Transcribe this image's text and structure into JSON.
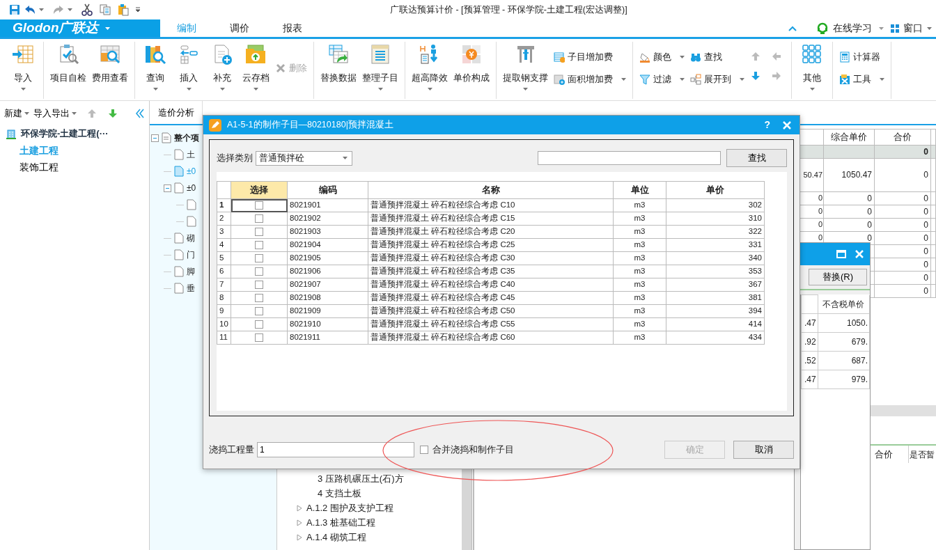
{
  "title_bar": {
    "title": "广联达预算计价 - [预算管理 - 环保学院-土建工程(宏达调整)]"
  },
  "ribbon_tabs": {
    "logo": "Glodon广联达",
    "tabs": [
      {
        "label": "编制",
        "selected": true
      },
      {
        "label": "调价",
        "selected": false
      },
      {
        "label": "报表",
        "selected": false
      }
    ],
    "right": [
      "在线学习",
      "窗口"
    ]
  },
  "ribbon": {
    "groups": [
      {
        "buttons": [
          {
            "kind": "large",
            "label": "导入",
            "dropdown": true,
            "disabled": false
          }
        ]
      },
      {
        "buttons": [
          {
            "kind": "large",
            "label": "项目自检",
            "dropdown": false,
            "disabled": false
          },
          {
            "kind": "large",
            "label": "费用查看",
            "dropdown": false,
            "disabled": false
          }
        ]
      },
      {
        "buttons": [
          {
            "kind": "large",
            "label": "查询",
            "dropdown": true,
            "disabled": false
          },
          {
            "kind": "large",
            "label": "插入",
            "dropdown": true,
            "disabled": false
          },
          {
            "kind": "large",
            "label": "补充",
            "dropdown": true,
            "disabled": false
          },
          {
            "kind": "large",
            "label": "云存档",
            "dropdown": true,
            "disabled": false
          },
          {
            "kind": "small",
            "label": "删除",
            "dropdown": false,
            "disabled": true
          }
        ]
      },
      {
        "buttons": [
          {
            "kind": "large",
            "label": "替换数据",
            "dropdown": false,
            "disabled": false
          },
          {
            "kind": "large",
            "label": "整理子目",
            "dropdown": true,
            "disabled": false
          }
        ]
      },
      {
        "buttons": [
          {
            "kind": "large",
            "label": "超高降效",
            "dropdown": true,
            "disabled": false
          },
          {
            "kind": "large",
            "label": "单价构成",
            "dropdown": false,
            "disabled": false
          }
        ]
      },
      {
        "buttons": [
          {
            "kind": "large",
            "label": "提取钢支撑",
            "dropdown": true,
            "disabled": false
          },
          {
            "kind": "stack",
            "items": [
              {
                "label": "子目增加费",
                "dropdown": false,
                "disabled": false
              },
              {
                "label": "面积增加费",
                "dropdown": true,
                "disabled": false
              }
            ]
          }
        ]
      },
      {
        "buttons": [
          {
            "kind": "stack",
            "items": [
              {
                "label": "颜色",
                "dropdown": true,
                "disabled": false
              },
              {
                "label": "过滤",
                "dropdown": true,
                "disabled": false
              }
            ]
          },
          {
            "kind": "stack",
            "items": [
              {
                "label": "查找",
                "dropdown": false,
                "disabled": false
              },
              {
                "label": "展开到",
                "dropdown": true,
                "disabled": false
              }
            ]
          },
          {
            "kind": "arrows",
            "items": [
              {
                "disabled": true
              },
              {
                "disabled": true
              },
              {
                "disabled": false
              },
              {
                "disabled": true
              }
            ]
          }
        ]
      },
      {
        "buttons": [
          {
            "kind": "large",
            "label": "其他",
            "dropdown": true,
            "disabled": false
          }
        ]
      },
      {
        "buttons": [
          {
            "kind": "stack",
            "items": [
              {
                "label": "计算器",
                "dropdown": false,
                "disabled": false
              },
              {
                "label": "工具",
                "dropdown": true,
                "disabled": false
              }
            ]
          }
        ]
      }
    ]
  },
  "left_panel": {
    "toolbar": [
      {
        "label": "新建"
      },
      {
        "label": "导入导出"
      }
    ],
    "move_buttons": [
      {
        "disabled": true
      },
      {
        "disabled": false
      }
    ],
    "tree": {
      "label": "环保学院-土建工程(···",
      "children": [
        {
          "label": "土建工程",
          "selected": true
        },
        {
          "label": "装饰工程",
          "selected": false
        }
      ]
    }
  },
  "main_tabs": [
    {
      "label": "造价分析",
      "selected": false
    }
  ],
  "item_tree": [
    {
      "label": "整个项",
      "selected": false,
      "expanded": true,
      "children": [
        {
          "label": "土",
          "selected": false
        },
        {
          "label": "±0",
          "selected": true
        },
        {
          "label": "±0",
          "selected": false,
          "expanded": true,
          "children": [
            {
              "selected": false
            },
            {
              "selected": false
            }
          ]
        },
        {
          "label": "砌",
          "selected": false
        },
        {
          "label": "门",
          "selected": false
        },
        {
          "label": "脚",
          "selected": false
        },
        {
          "label": "垂",
          "selected": false
        }
      ]
    }
  ],
  "library_tree": [
    {
      "children": [
        {
          "label": "3 压路机碾压土(石)方"
        },
        {
          "label": "4 支挡土板"
        }
      ]
    },
    {
      "label": "A.1.2 围护及支护工程",
      "expanded": false
    },
    {
      "label": "A.1.3 桩基础工程",
      "expanded": false
    },
    {
      "label": "A.1.4 砌筑工程",
      "expanded": false
    }
  ],
  "cost_grid": {
    "columns": [
      "综合单价",
      "合价"
    ],
    "rows": [
      {
        "kind": "summary",
        "total": "0"
      },
      {
        "kind": "item",
        "column_1": "50.47",
        "unit_price": "1050.47",
        "total": "0"
      },
      {
        "kind": "item",
        "column_1": "0",
        "unit_price": "0",
        "total": "0"
      },
      {
        "kind": "item",
        "column_1": "0",
        "unit_price": "0",
        "total": "0"
      },
      {
        "kind": "item",
        "column_1": "0",
        "unit_price": "0",
        "total": "0"
      },
      {
        "kind": "item",
        "column_1": "0",
        "unit_price": "0",
        "total": "0"
      },
      {
        "kind": "item",
        "total": "0"
      },
      {
        "kind": "item",
        "total": "0"
      },
      {
        "kind": "item",
        "total": "0"
      },
      {
        "kind": "item",
        "total": "0"
      }
    ]
  },
  "lower_grid": {
    "columns": [
      "合价",
      "是否暂"
    ]
  },
  "replace_dialog": {
    "button": "替换(R)",
    "column": "不含税单价",
    "rows": [
      {
        "column_1": ".47",
        "price": "1050."
      },
      {
        "column_1": ".92",
        "price": "679."
      },
      {
        "column_1": ".52",
        "price": "687."
      },
      {
        "column_1": ".47",
        "price": "979."
      }
    ]
  },
  "dialog": {
    "title": "A1-5-1的制作子目—80210180|预拌混凝土",
    "help": "?",
    "category_label": "选择类别",
    "category": "普通预拌砼",
    "find_button": "查找",
    "table": {
      "columns": [
        {
          "label": "选择",
          "selected": true
        },
        {
          "label": "编码",
          "selected": false
        },
        {
          "label": "名称",
          "selected": false
        },
        {
          "label": "单位",
          "selected": false
        },
        {
          "label": "单价",
          "selected": false
        }
      ],
      "rows": [
        {
          "number": "1",
          "current": true,
          "checked": false,
          "code": "8021901",
          "name": "普通预拌混凝土 碎石粒径综合考虑 C10",
          "unit": "m3",
          "price": "302"
        },
        {
          "number": "2",
          "current": false,
          "checked": false,
          "code": "8021902",
          "name": "普通预拌混凝土 碎石粒径综合考虑 C15",
          "unit": "m3",
          "price": "310"
        },
        {
          "number": "3",
          "current": false,
          "checked": false,
          "code": "8021903",
          "name": "普通预拌混凝土 碎石粒径综合考虑 C20",
          "unit": "m3",
          "price": "322"
        },
        {
          "number": "4",
          "current": false,
          "checked": false,
          "code": "8021904",
          "name": "普通预拌混凝土 碎石粒径综合考虑 C25",
          "unit": "m3",
          "price": "331"
        },
        {
          "number": "5",
          "current": false,
          "checked": false,
          "code": "8021905",
          "name": "普通预拌混凝土 碎石粒径综合考虑 C30",
          "unit": "m3",
          "price": "340"
        },
        {
          "number": "6",
          "current": false,
          "checked": false,
          "code": "8021906",
          "name": "普通预拌混凝土 碎石粒径综合考虑 C35",
          "unit": "m3",
          "price": "353"
        },
        {
          "number": "7",
          "current": false,
          "checked": false,
          "code": "8021907",
          "name": "普通预拌混凝土 碎石粒径综合考虑 C40",
          "unit": "m3",
          "price": "367"
        },
        {
          "number": "8",
          "current": false,
          "checked": false,
          "code": "8021908",
          "name": "普通预拌混凝土 碎石粒径综合考虑 C45",
          "unit": "m3",
          "price": "381"
        },
        {
          "number": "9",
          "current": false,
          "checked": false,
          "code": "8021909",
          "name": "普通预拌混凝土 碎石粒径综合考虑 C50",
          "unit": "m3",
          "price": "394"
        },
        {
          "number": "10",
          "current": false,
          "checked": false,
          "code": "8021910",
          "name": "普通预拌混凝土 碎石粒径综合考虑 C55",
          "unit": "m3",
          "price": "414"
        },
        {
          "number": "11",
          "current": false,
          "checked": false,
          "code": "8021911",
          "name": "普通预拌混凝土 碎石粒径综合考虑 C60",
          "unit": "m3",
          "price": "434"
        }
      ]
    },
    "quantity_label": "浇捣工程量",
    "quantity": "1",
    "merge": {
      "label": "合并浇捣和制作子目",
      "checked": false
    },
    "buttons": [
      {
        "label": "确定",
        "disabled": true
      },
      {
        "label": "取消",
        "disabled": false
      }
    ]
  }
}
